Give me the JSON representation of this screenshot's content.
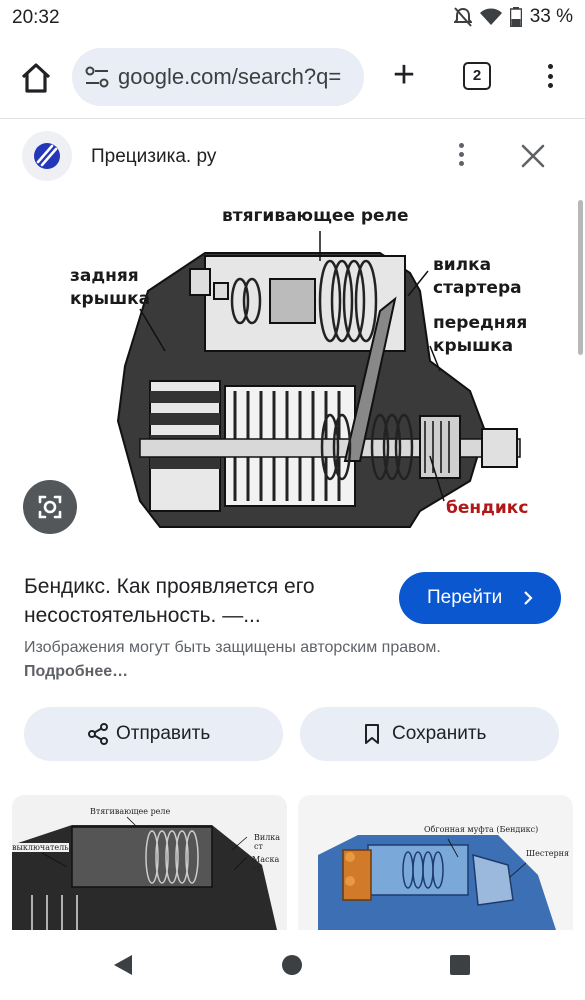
{
  "status_bar": {
    "time": "20:32",
    "battery": "33 %",
    "icons": [
      "alarm-off-icon",
      "wifi-icon",
      "battery-icon"
    ]
  },
  "browser": {
    "url": "google.com/search?q=",
    "tab_count": "2",
    "icons": [
      "home-icon",
      "tune-icon",
      "new-tab-plus-icon",
      "tab-switcher-icon",
      "menu-dots-icon"
    ]
  },
  "source": {
    "name": "Прецизика. ру",
    "icons": [
      "site-logo-icon",
      "more-vert-icon",
      "close-icon"
    ]
  },
  "image_labels": {
    "relay": "втягивающее реле",
    "rear_cover_1": "задняя",
    "rear_cover_2": "крышка",
    "fork_1": "вилка",
    "fork_2": "стартера",
    "front_cover_1": "передняя",
    "front_cover_2": "крышка",
    "bendix": "бендикс"
  },
  "result": {
    "title": "Бендикс. Как проявляется его несостоятельность. —...",
    "visit_label": "Перейти",
    "copyright_text": "Изображения могут быть защищены авторским правом.",
    "more_link": "Подробнее…"
  },
  "actions": {
    "share_label": "Отправить",
    "save_label": "Сохранить"
  },
  "thumbnails": {
    "thumb1_caption_top": "Втягивающее реле",
    "thumb1_caption_left": "выключатель",
    "thumb1_caption_right1": "Вилка ст",
    "thumb1_caption_right2": "Маска ст",
    "thumb2_caption_top": "Обгонная муфта (Бендикс)",
    "thumb2_caption_right": "Шестерня"
  },
  "colors": {
    "accent": "#0b57d0",
    "chip_bg": "#e8edf6",
    "label_red": "#b01818"
  }
}
